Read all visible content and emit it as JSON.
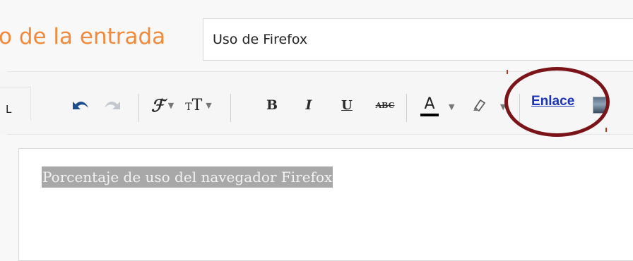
{
  "post_title": {
    "label": "o de la entrada",
    "value": "Uso de Firefox"
  },
  "toolbar": {
    "html_tab_label": "L",
    "undo_icon": "undo-icon",
    "redo_icon": "redo-icon",
    "font_icon": "font-family-icon",
    "font_size_icon": "font-size-icon",
    "bold_label": "B",
    "italic_label": "I",
    "underline_label": "U",
    "strike_label": "ABC",
    "text_color_label": "A",
    "highlight_icon": "highlighter-icon",
    "link_label": "Enlace",
    "image_icon": "insert-image-icon"
  },
  "editor": {
    "content": "Porcentaje de uso del navegador Firefox"
  },
  "colors": {
    "title_orange": "#f08a3c",
    "link_blue": "#1a33b8",
    "callout_red": "#7a1418",
    "selection_gray": "#a8a8a8"
  }
}
